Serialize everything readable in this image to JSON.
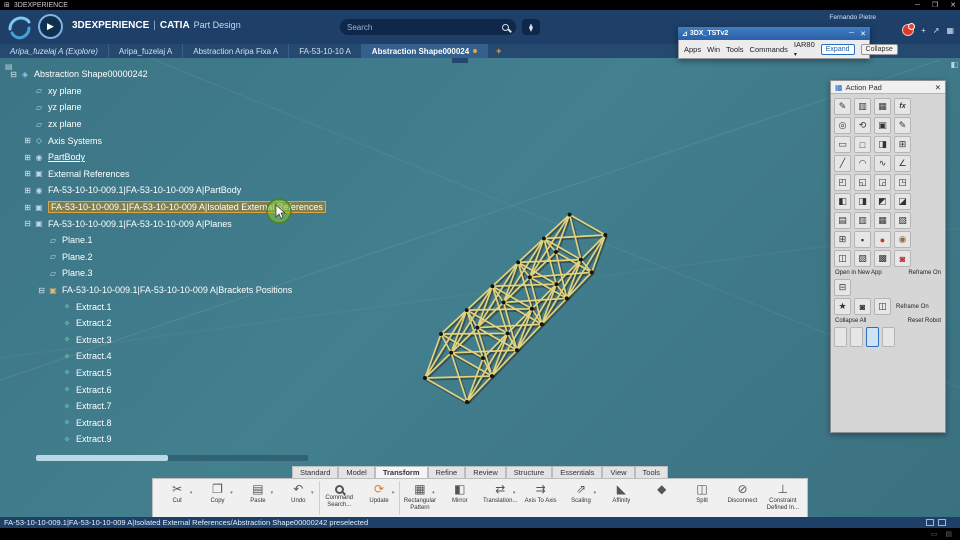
{
  "window": {
    "title": "3DEXPERIENCE",
    "minimize": "─",
    "maximize": "❐",
    "close": "✕"
  },
  "header": {
    "brand": "3DEXPERIENCE",
    "separator": "|",
    "app": "CATIA",
    "module": "Part Design",
    "search_placeholder": "Search",
    "user": "Fernando Pietre"
  },
  "tabs": {
    "items": [
      {
        "label": "Aripa_fuzelaj A (Explore)"
      },
      {
        "label": "Aripa_fuzelaj A"
      },
      {
        "label": "Abstraction Aripa Fixa A"
      },
      {
        "label": "FA-53-10-10 A"
      },
      {
        "label": "Abstraction Shape000024"
      }
    ],
    "add_label": "+"
  },
  "robot": {
    "title": "3DX_TSTv2",
    "menu": [
      "Apps",
      "Win",
      "Tools",
      "Commands",
      "IAR80"
    ],
    "expand": "Expand",
    "collapse": "Collapse",
    "minimize": "─",
    "close": "✕"
  },
  "tree": {
    "items": [
      {
        "label": "Abstraction Shape00000242",
        "d": 0,
        "exp": "-",
        "icon": "◈",
        "k": "root"
      },
      {
        "label": "xy plane",
        "d": 1,
        "icon": "▱",
        "k": "plane"
      },
      {
        "label": "yz plane",
        "d": 1,
        "icon": "▱",
        "k": "plane"
      },
      {
        "label": "zx plane",
        "d": 1,
        "icon": "▱",
        "k": "plane"
      },
      {
        "label": "Axis Systems",
        "d": 1,
        "exp": "+",
        "icon": "◇",
        "k": "axis"
      },
      {
        "label": "PartBody",
        "d": 1,
        "exp": "+",
        "icon": "◉",
        "k": "body",
        "u": true
      },
      {
        "label": "External References",
        "d": 1,
        "exp": "+",
        "icon": "▣",
        "k": "ref"
      },
      {
        "label": "FA-53-10-10-009.1|FA-53-10-10-009 A|PartBody",
        "d": 1,
        "exp": "+",
        "icon": "◉",
        "k": "body"
      },
      {
        "label": "FA-53-10-10-009.1|FA-53-10-10-009 A|Isolated External References",
        "d": 1,
        "exp": "+",
        "icon": "▣",
        "k": "ref",
        "sel": true
      },
      {
        "label": "FA-53-10-10-009.1|FA-53-10-10-009 A|Planes",
        "d": 1,
        "exp": "-",
        "icon": "▣",
        "k": "ref"
      },
      {
        "label": "Plane.1",
        "d": 2,
        "icon": "▱",
        "k": "plane"
      },
      {
        "label": "Plane.2",
        "d": 2,
        "icon": "▱",
        "k": "plane"
      },
      {
        "label": "Plane.3",
        "d": 2,
        "icon": "▱",
        "k": "plane"
      },
      {
        "label": "FA-53-10-10-009.1|FA-53-10-10-009 A|Brackets Positions",
        "d": 2,
        "exp": "-",
        "icon": "▣",
        "k": "br"
      },
      {
        "label": "Extract.1",
        "d": 3,
        "icon": "✧",
        "k": "ex"
      },
      {
        "label": "Extract.2",
        "d": 3,
        "icon": "✧",
        "k": "ex"
      },
      {
        "label": "Extract.3",
        "d": 3,
        "icon": "✧",
        "k": "ex"
      },
      {
        "label": "Extract.4",
        "d": 3,
        "icon": "✧",
        "k": "ex"
      },
      {
        "label": "Extract.5",
        "d": 3,
        "icon": "✧",
        "k": "ex"
      },
      {
        "label": "Extract.6",
        "d": 3,
        "icon": "✧",
        "k": "ex"
      },
      {
        "label": "Extract.7",
        "d": 3,
        "icon": "✧",
        "k": "ex"
      },
      {
        "label": "Extract.8",
        "d": 3,
        "icon": "✧",
        "k": "ex"
      },
      {
        "label": "Extract.9",
        "d": 3,
        "icon": "✧",
        "k": "ex"
      }
    ]
  },
  "action_pad": {
    "title": "Action Pad",
    "close": "✕",
    "rows": [
      {
        "t": "icons",
        "g": [
          "✎",
          "▥",
          "▦",
          "fx"
        ]
      },
      {
        "t": "icons",
        "g": [
          "◎",
          "⟲",
          "▣",
          "✎"
        ]
      },
      {
        "t": "icons",
        "g": [
          "▭",
          "□",
          "◨",
          "⊞"
        ]
      },
      {
        "t": "icons",
        "g": [
          "╱",
          "◠",
          "∿",
          "∠"
        ]
      },
      {
        "t": "icons",
        "g": [
          "◰",
          "◱",
          "◲",
          "◳"
        ]
      },
      {
        "t": "icons",
        "g": [
          "◧",
          "◨",
          "◩",
          "◪"
        ]
      },
      {
        "t": "icons",
        "g": [
          "▤",
          "▥",
          "▦",
          "▧"
        ]
      },
      {
        "t": "icons",
        "g": [
          "⊞",
          "▪",
          {
            "g": "●",
            "c": "#c0392b"
          },
          {
            "g": "◉",
            "c": "#8e6f3e"
          }
        ]
      },
      {
        "t": "icons",
        "g": [
          "◫",
          "▨",
          "▩",
          {
            "g": "◙",
            "c": "#b03030"
          }
        ]
      },
      {
        "t": "labels",
        "g": [
          "Open in New App",
          "Reframe On"
        ]
      },
      {
        "t": "icons",
        "g": [
          "⊟"
        ]
      },
      {
        "t": "mixed",
        "g": [
          "★",
          "◙",
          "◫"
        ],
        "label": "Reframe On"
      },
      {
        "t": "labels",
        "g": [
          "Collapse All",
          "Reset Robot"
        ]
      },
      {
        "t": "toggles",
        "g": [
          "□",
          "□",
          {
            "g": "□",
            "sel": true
          },
          "□"
        ]
      }
    ]
  },
  "ribbon": {
    "sections": [
      "Standard",
      "Model",
      "Transform",
      "Refine",
      "Review",
      "Structure",
      "Essentials",
      "View",
      "Tools"
    ],
    "active_section": "Transform",
    "tools": [
      {
        "n": "cut",
        "g": "✂",
        "label": "Cut",
        "caret": true
      },
      {
        "n": "copy",
        "g": "❐",
        "label": "Copy",
        "caret": true
      },
      {
        "n": "paste",
        "g": "▤",
        "label": "Paste",
        "caret": true
      },
      {
        "n": "undo",
        "g": "↶",
        "label": "Undo",
        "caret": true
      },
      {
        "n": "command-search",
        "mag": true,
        "label": "Command Search...",
        "sep": true
      },
      {
        "n": "update",
        "g": "⟳",
        "label": "Update",
        "caret": true,
        "c": "orange"
      },
      {
        "n": "rectangular-pattern",
        "g": "▦",
        "label": "Rectangular Pattern",
        "caret": true,
        "sep": true
      },
      {
        "n": "mirror",
        "g": "◧",
        "label": "Mirror"
      },
      {
        "n": "translation",
        "g": "⇄",
        "label": "Translation...",
        "caret": true
      },
      {
        "n": "axis-to-axis",
        "g": "⇉",
        "label": "Axis To Axis"
      },
      {
        "n": "scaling",
        "g": "⇗",
        "label": "Scaling",
        "caret": true
      },
      {
        "n": "affinity",
        "g": "◣",
        "label": "Affinity"
      },
      {
        "n": "transform-tool",
        "g": "◆",
        "label": ""
      },
      {
        "n": "split",
        "g": "◫",
        "label": "Split"
      },
      {
        "n": "disconnect",
        "g": "⊘",
        "label": "Disconnect"
      },
      {
        "n": "constraint-defined-in",
        "g": "⊥",
        "label": "Constraint Defined In..."
      }
    ]
  },
  "status": {
    "text": "FA-53-10-10-009.1|FA-53-10-10-009 A|Isolated External References/Abstraction Shape00000242 preselected"
  }
}
